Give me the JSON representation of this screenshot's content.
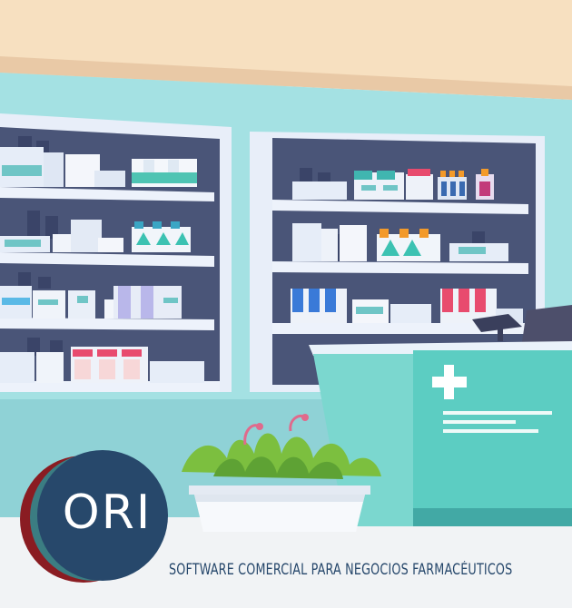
{
  "brand": {
    "logo_text": "ORI",
    "tagline": "SOFTWARE COMERCIAL PARA NEGOCIOS FARMACÉUTICOS"
  },
  "colors": {
    "ceiling": "#f7e0c0",
    "wall": "#a4e1e3",
    "shelf_frame": "#e8eef9",
    "shelf_back": "#4a5578",
    "counter": "#5ccdc2",
    "floor": "#f1f3f5",
    "logo_blue": "#27486b",
    "logo_red": "#8a1c22",
    "logo_teal": "#3b7d82"
  },
  "icons": [
    "cross-icon",
    "cash-register-icon",
    "plant-icon"
  ]
}
